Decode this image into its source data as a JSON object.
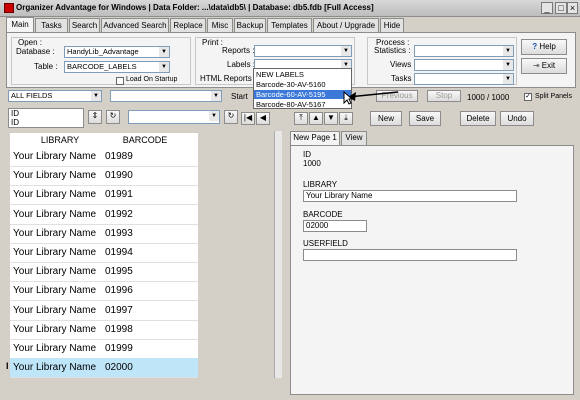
{
  "window": {
    "title": "Organizer Advantage for Windows | Data Folder: ...\\data\\db5\\ | Database: db5.fdb [Full Access]"
  },
  "tabs": [
    "Main",
    "Tasks",
    "Search",
    "Advanced Search",
    "Replace",
    "Misc",
    "Backup",
    "Templates",
    "About / Upgrade",
    "Hide"
  ],
  "open": {
    "group": "Open :",
    "database_label": "Database :",
    "database_value": "HandyLib_Advantage",
    "table_label": "Table :",
    "table_value": "BARCODE_LABELS",
    "load_on_startup": "Load On Startup"
  },
  "print": {
    "group": "Print :",
    "reports_label": "Reports :",
    "labels_label": "Labels :",
    "html_reports_label": "HTML Reports :"
  },
  "process": {
    "group": "Process :",
    "statistics_label": "Statistics :",
    "views_label": "Views :",
    "tasks_label": "Tasks :"
  },
  "buttons": {
    "help": "Help",
    "exit": "Exit",
    "new": "New",
    "save": "Save",
    "delete": "Delete",
    "undo": "Undo",
    "previous": "Previous",
    "stop": "Stop"
  },
  "filter": {
    "field": "ALL FIELDS",
    "start_label": "Start",
    "record_count": "1000 / 1000",
    "split_panels": "Split Panels"
  },
  "sort": {
    "field_line1": "ID",
    "field_line2": "ID"
  },
  "dropdown_items": [
    "NEW LABELS",
    "Barcode-30-AV-5160",
    "Barcode-60-AV-5195",
    "Barcode-80-AV-5167"
  ],
  "grid": {
    "columns": [
      "LIBRARY",
      "BARCODE"
    ],
    "rows": [
      [
        "Your Library Name",
        "01989"
      ],
      [
        "Your Library Name",
        "01990"
      ],
      [
        "Your Library Name",
        "01991"
      ],
      [
        "Your Library Name",
        "01992"
      ],
      [
        "Your Library Name",
        "01993"
      ],
      [
        "Your Library Name",
        "01994"
      ],
      [
        "Your Library Name",
        "01995"
      ],
      [
        "Your Library Name",
        "01996"
      ],
      [
        "Your Library Name",
        "01997"
      ],
      [
        "Your Library Name",
        "01998"
      ],
      [
        "Your Library Name",
        "01999"
      ],
      [
        "Your Library Name",
        "02000"
      ]
    ],
    "current_marker": "I"
  },
  "detail_tabs": [
    "New Page 1",
    "View"
  ],
  "detail": {
    "id_label": "ID",
    "id_value": "1000",
    "library_label": "LIBRARY",
    "library_value": "Your Library Name",
    "barcode_label": "BARCODE",
    "barcode_value": "02000",
    "userfield_label": "USERFIELD",
    "userfield_value": ""
  },
  "colors": {
    "selected_row": "#bfe6f8",
    "dropdown_highlight": "#3b78d8"
  }
}
